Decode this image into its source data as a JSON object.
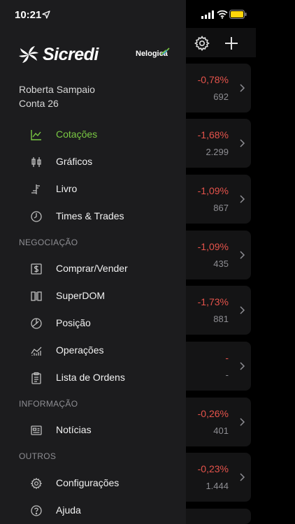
{
  "status_bar": {
    "time": "10:21"
  },
  "brand": {
    "name": "Sicredi",
    "partner": "Nelogica",
    "accent": "#7ac943"
  },
  "user": {
    "name": "Roberta Sampaio",
    "account": "Conta 26"
  },
  "menu": {
    "main": [
      {
        "label": "Cotações",
        "icon": "chart-line-icon",
        "active": true
      },
      {
        "label": "Gráficos",
        "icon": "candlestick-icon"
      },
      {
        "label": "Livro",
        "icon": "book-bars-icon"
      },
      {
        "label": "Times & Trades",
        "icon": "clock-icon"
      }
    ],
    "negociacao_title": "NEGOCIAÇÃO",
    "negociacao": [
      {
        "label": "Comprar/Vender",
        "icon": "dollar-box-icon"
      },
      {
        "label": "SuperDOM",
        "icon": "columns-icon"
      },
      {
        "label": "Posição",
        "icon": "pie-icon"
      },
      {
        "label": "Operações",
        "icon": "operations-icon"
      },
      {
        "label": "Lista de Ordens",
        "icon": "clipboard-icon"
      }
    ],
    "informacao_title": "INFORMAÇÃO",
    "informacao": [
      {
        "label": "Notícias",
        "icon": "newspaper-icon"
      }
    ],
    "outros_title": "OUTROS",
    "outros": [
      {
        "label": "Configurações",
        "icon": "gear-icon"
      },
      {
        "label": "Ajuda",
        "icon": "help-icon"
      }
    ]
  },
  "quotes": [
    {
      "change": "-0,78%",
      "volume": "692"
    },
    {
      "change": "-1,68%",
      "volume": "2.299"
    },
    {
      "change": "-1,09%",
      "volume": "867"
    },
    {
      "change": "-1,09%",
      "volume": "435"
    },
    {
      "change": "-1,73%",
      "volume": "881"
    },
    {
      "change": "-",
      "volume": "-"
    },
    {
      "change": "-0,26%",
      "volume": "401"
    },
    {
      "change": "-0,23%",
      "volume": "1.444"
    }
  ]
}
